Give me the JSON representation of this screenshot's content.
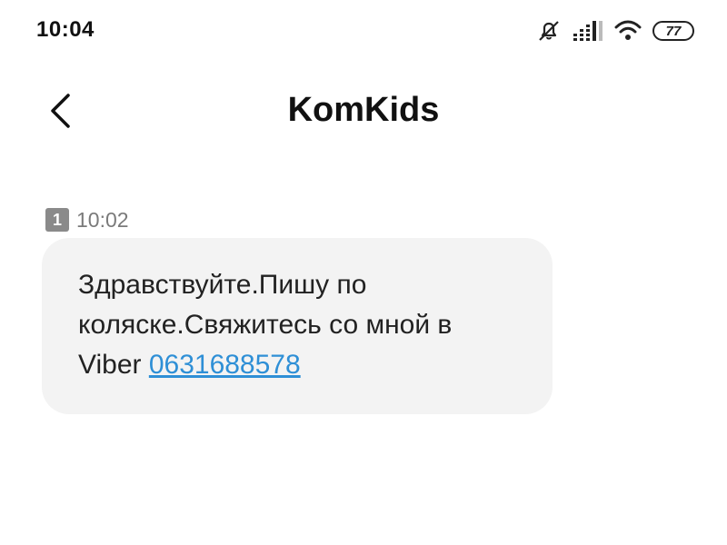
{
  "status_bar": {
    "time": "10:04",
    "battery_level": "77",
    "icons": [
      "mute-icon",
      "signal-icon",
      "wifi-icon",
      "battery-icon"
    ]
  },
  "header": {
    "back_icon": "chevron-left-icon",
    "title": "KomKids"
  },
  "message": {
    "sim_badge": "1",
    "time": "10:02",
    "text_line1": "Здравствуйте.Пишу по",
    "text_line2": "коляске.Свяжитесь со мной в",
    "text_line3_prefix": "Viber ",
    "phone": "0631688578"
  },
  "colors": {
    "link": "#2e8fd6",
    "bubble": "#f3f3f3",
    "meta_gray": "#7a7a7a"
  }
}
